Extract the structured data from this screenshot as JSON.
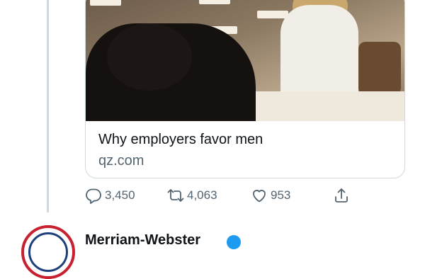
{
  "link_card": {
    "title": "Why employers favor men",
    "domain": "qz.com"
  },
  "actions": {
    "reply_count": "3,450",
    "retweet_count": "4,063",
    "like_count": "953"
  },
  "next_tweet": {
    "author_name": "Merriam-Webster"
  },
  "icons": [
    "reply-icon",
    "retweet-icon",
    "like-icon",
    "share-icon",
    "verified-badge-icon"
  ],
  "colors": {
    "text": "#0f1419",
    "muted": "#536471",
    "border": "#cfd9de",
    "verified": "#1d9bf0"
  }
}
